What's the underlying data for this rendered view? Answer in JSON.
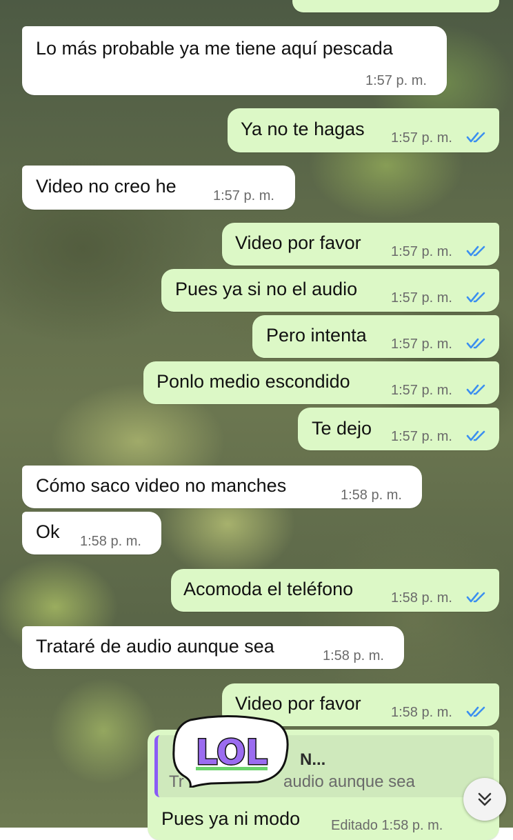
{
  "messages": [
    {
      "dir": "in",
      "text": "Lo más probable ya me tiene aquí pescada",
      "time": "1:57 p. m."
    },
    {
      "dir": "out",
      "text": "Ya no te hagas",
      "time": "1:57 p. m."
    },
    {
      "dir": "in",
      "text": "Video no creo he",
      "time": "1:57 p. m."
    },
    {
      "dir": "out",
      "text": "Video por favor",
      "time": "1:57 p. m."
    },
    {
      "dir": "out",
      "text": "Pues ya si no el audio",
      "time": "1:57 p. m."
    },
    {
      "dir": "out",
      "text": "Pero intenta",
      "time": "1:57 p. m."
    },
    {
      "dir": "out",
      "text": "Ponlo medio escondido",
      "time": "1:57 p. m."
    },
    {
      "dir": "out",
      "text": "Te dejo",
      "time": "1:57 p. m."
    },
    {
      "dir": "in",
      "text": "Cómo saco video no manches",
      "time": "1:58 p. m."
    },
    {
      "dir": "in",
      "text": "Ok",
      "time": "1:58 p. m."
    },
    {
      "dir": "out",
      "text": "Acomoda el teléfono",
      "time": "1:58 p. m."
    },
    {
      "dir": "in",
      "text": "Trataré de audio aunque sea",
      "time": "1:58 p. m."
    },
    {
      "dir": "out",
      "text": "Video por favor",
      "time": "1:58 p. m."
    }
  ],
  "reply_message": {
    "quoted_author": "N...",
    "quoted_text": "audio aunque sea",
    "quoted_prefix": "Tr",
    "text": "Pues ya ni modo",
    "time": "Editado 1:58 p. m."
  },
  "sticker": {
    "label": "LOL",
    "icon": "lol-sticker"
  },
  "scroll_button": {
    "icon": "chevron-double-down-icon"
  },
  "colors": {
    "incoming_bubble": "#ffffff",
    "outgoing_bubble": "#dcf8c6",
    "read_ticks": "#3b8ff0",
    "reply_accent": "#8a5cf6"
  }
}
